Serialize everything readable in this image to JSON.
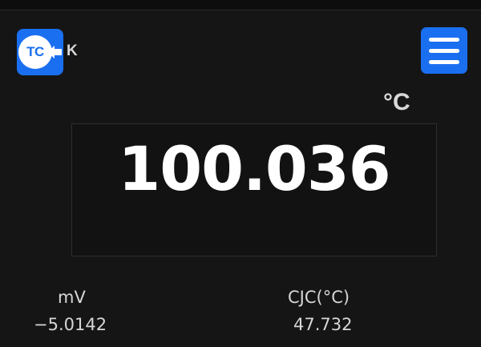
{
  "header": {
    "sensor_badge": {
      "label": "TC",
      "icon": "thermocouple-input-icon",
      "type": "K"
    },
    "menu": {
      "icon": "hamburger-menu-icon"
    }
  },
  "display": {
    "unit": "°C",
    "value": "100.036"
  },
  "readouts": {
    "mv": {
      "label": "mV",
      "value": "−5.0142"
    },
    "cjc": {
      "label": "CJC(°C)",
      "value": "47.732"
    }
  },
  "colors": {
    "background": "#151515",
    "accent": "#1a6ff0",
    "text": "#ffffff"
  }
}
